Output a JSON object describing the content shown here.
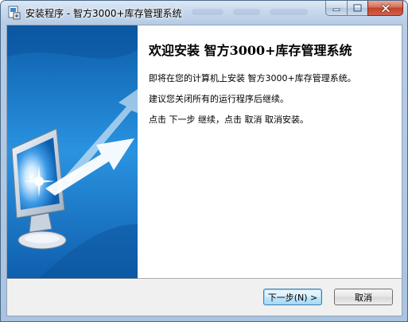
{
  "window": {
    "title": "安装程序 - 智方3000+库存管理系统"
  },
  "caption_buttons": {
    "minimize_icon": "minimize-icon",
    "maximize_icon": "maximize-icon",
    "close_icon": "close-icon"
  },
  "welcome": {
    "heading": "欢迎安装 智方3000+库存管理系统",
    "line1": "即将在您的计算机上安装 智方3000+库存管理系统。",
    "line2": "建议您关闭所有的运行程序后继续。",
    "line3": "点击 下一步 继续，点击 取消 取消安装。"
  },
  "footer": {
    "next_label": "下一步(N) >",
    "cancel_label": "取消"
  },
  "colors": {
    "side_panel": "#1f7fd0",
    "close_button": "#c0432b",
    "default_button_border": "#3c7fb1"
  }
}
